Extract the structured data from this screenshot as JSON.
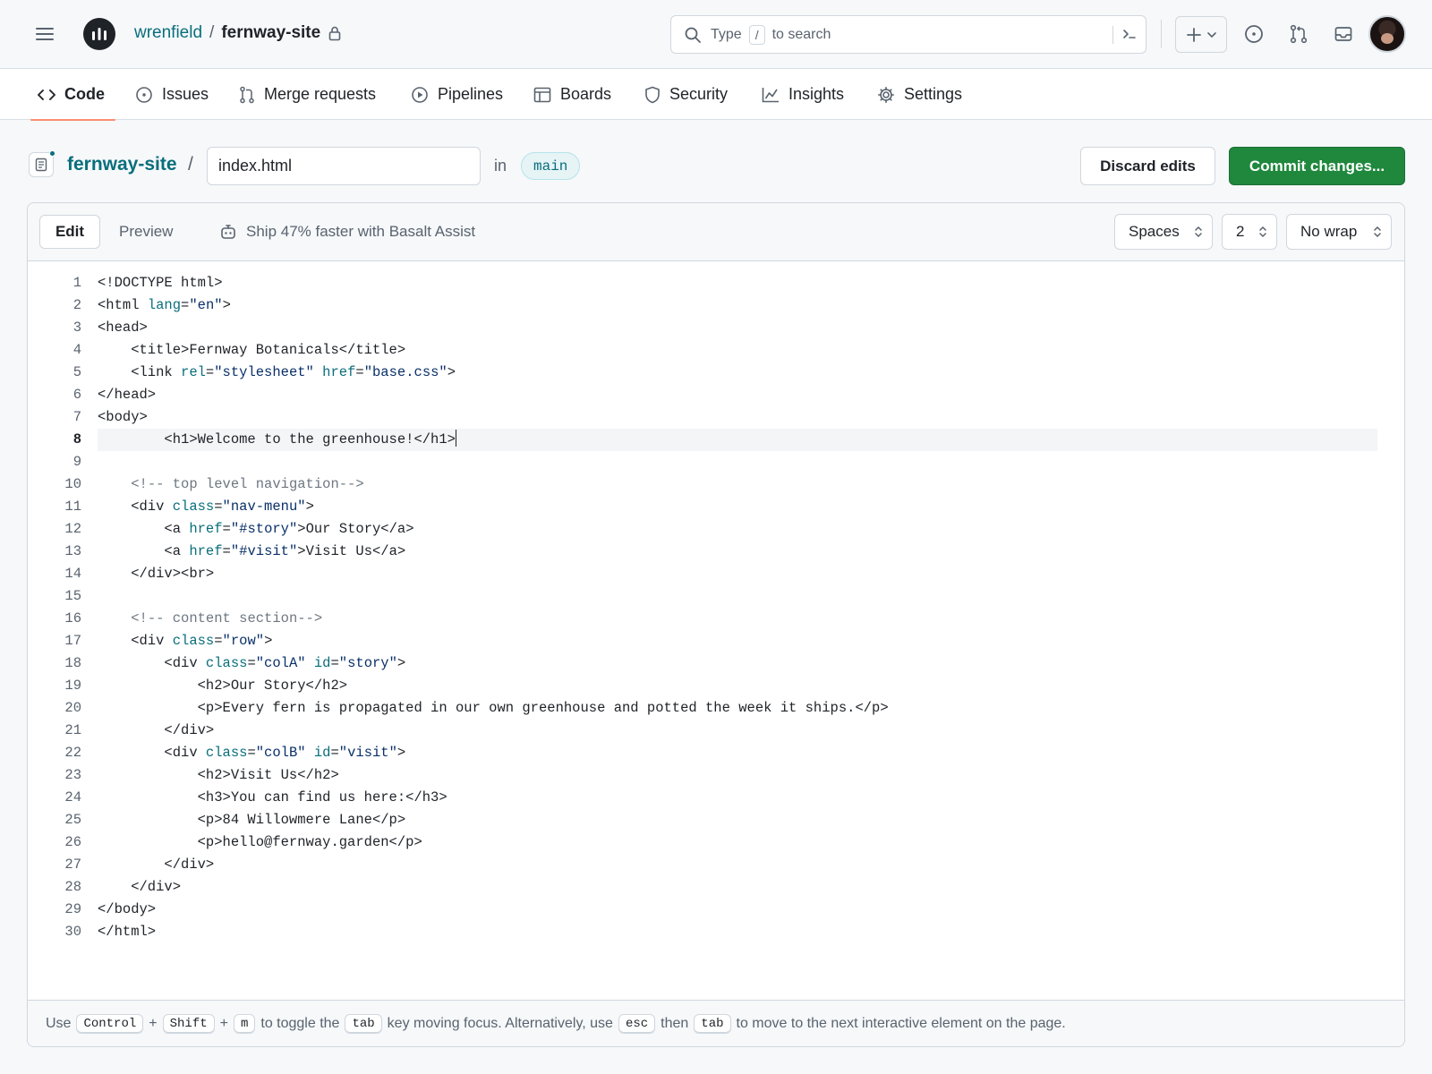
{
  "header": {
    "owner": "wrenfield",
    "separator": "/",
    "repo": "fernway-site",
    "search": {
      "type_label": "Type",
      "key": "/",
      "suffix": "to search"
    }
  },
  "tabs": [
    {
      "label": "Code",
      "icon": "code-icon",
      "active": true
    },
    {
      "label": "Issues",
      "icon": "issue-icon"
    },
    {
      "label": "Merge requests",
      "icon": "merge-request-icon"
    },
    {
      "label": "Pipelines",
      "icon": "play-icon"
    },
    {
      "label": "Boards",
      "icon": "board-icon"
    },
    {
      "label": "Security",
      "icon": "shield-icon"
    },
    {
      "label": "Insights",
      "icon": "graph-icon"
    },
    {
      "label": "Settings",
      "icon": "gear-icon"
    }
  ],
  "file": {
    "repo": "fernway-site",
    "separator": "/",
    "filename": "index.html",
    "in_label": "in",
    "branch": "main",
    "discard_label": "Discard edits",
    "commit_label": "Commit changes..."
  },
  "editor_toolbar": {
    "edit_label": "Edit",
    "preview_label": "Preview",
    "assist_text": "Ship 47% faster with Basalt Assist",
    "indent_mode": "Spaces",
    "indent_size": "2",
    "wrap_mode": "No wrap"
  },
  "code": {
    "current_line": 8,
    "lines": [
      "<!DOCTYPE html>",
      "<html lang=\"en\">",
      "<head>",
      "    <title>Fernway Botanicals</title>",
      "    <link rel=\"stylesheet\" href=\"base.css\">",
      "</head>",
      "<body>",
      "        <h1>Welcome to the greenhouse!</h1>",
      "",
      "    <!-- top level navigation-->",
      "    <div class=\"nav-menu\">",
      "        <a href=\"#story\">Our Story</a>",
      "        <a href=\"#visit\">Visit Us</a>",
      "    </div><br>",
      "",
      "    <!-- content section-->",
      "    <div class=\"row\">",
      "        <div class=\"colA\" id=\"story\">",
      "            <h2>Our Story</h2>",
      "            <p>Every fern is propagated in our own greenhouse and potted the week it ships.</p>",
      "        </div>",
      "        <div class=\"colB\" id=\"visit\">",
      "            <h2>Visit Us</h2>",
      "            <h3>You can find us here:</h3>",
      "            <p>84 Willowmere Lane</p>",
      "            <p>hello@fernway.garden</p>",
      "        </div>",
      "    </div>",
      "</body>",
      "</html>"
    ]
  },
  "footer": {
    "use": "Use",
    "key_control": "Control",
    "plus1": "+",
    "key_shift": "Shift",
    "plus2": "+",
    "key_m": "m",
    "toggle_text": "to toggle the",
    "key_tab": "tab",
    "moving_text": "key moving focus. Alternatively, use",
    "key_esc": "esc",
    "then": "then",
    "key_tab2": "tab",
    "next_text": "to move to the next interactive element on the page."
  },
  "colors": {
    "accent": "#0a6e7c",
    "commit": "#1f883d",
    "active_tab": "#fd8c73"
  }
}
